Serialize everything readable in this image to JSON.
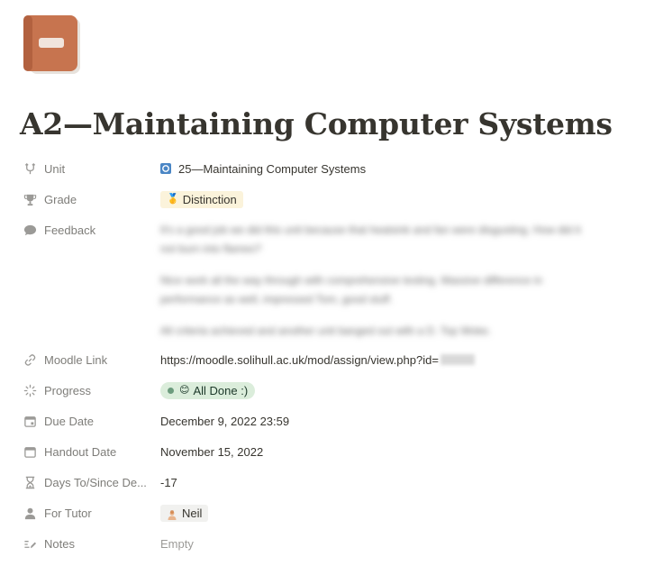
{
  "page": {
    "icon": "book-icon",
    "title": "A2—Maintaining Computer Systems"
  },
  "properties": {
    "unit": {
      "label": "Unit",
      "icon": "relation-arrow-icon",
      "value": "25—Maintaining Computer Systems"
    },
    "grade": {
      "label": "Grade",
      "icon": "trophy-icon",
      "emoji": "🥇",
      "value": "Distinction",
      "color": "#fbf3db"
    },
    "feedback": {
      "label": "Feedback",
      "icon": "comment-icon",
      "paragraphs": [
        "It's a good job we did this unit because that heatsink and fan were disgusting. How did it not burn into flames?",
        "Nice work all the way through with comprehensive testing. Massive difference in performance as well, impressed Tom, good stuff.",
        "All criteria achieved and another unit banged out with a D. Top Woke."
      ]
    },
    "moodle_link": {
      "label": "Moodle Link",
      "icon": "link-icon",
      "value": "https://moodle.solihull.ac.uk/mod/assign/view.php?id="
    },
    "progress": {
      "label": "Progress",
      "icon": "status-icon",
      "emoji": "😊",
      "value": "All Done :)",
      "color": "#dbeddb"
    },
    "due_date": {
      "label": "Due Date",
      "icon": "calendar-icon",
      "value": "December 9, 2022 23:59"
    },
    "handout_date": {
      "label": "Handout Date",
      "icon": "calendar-icon",
      "value": "November 15, 2022"
    },
    "days_to_since": {
      "label": "Days To/Since De...",
      "icon": "hourglass-icon",
      "value": "-17"
    },
    "for_tutor": {
      "label": "For Tutor",
      "icon": "person-icon",
      "value": "Neil"
    },
    "notes": {
      "label": "Notes",
      "icon": "edit-lines-icon",
      "value": "Empty"
    }
  }
}
